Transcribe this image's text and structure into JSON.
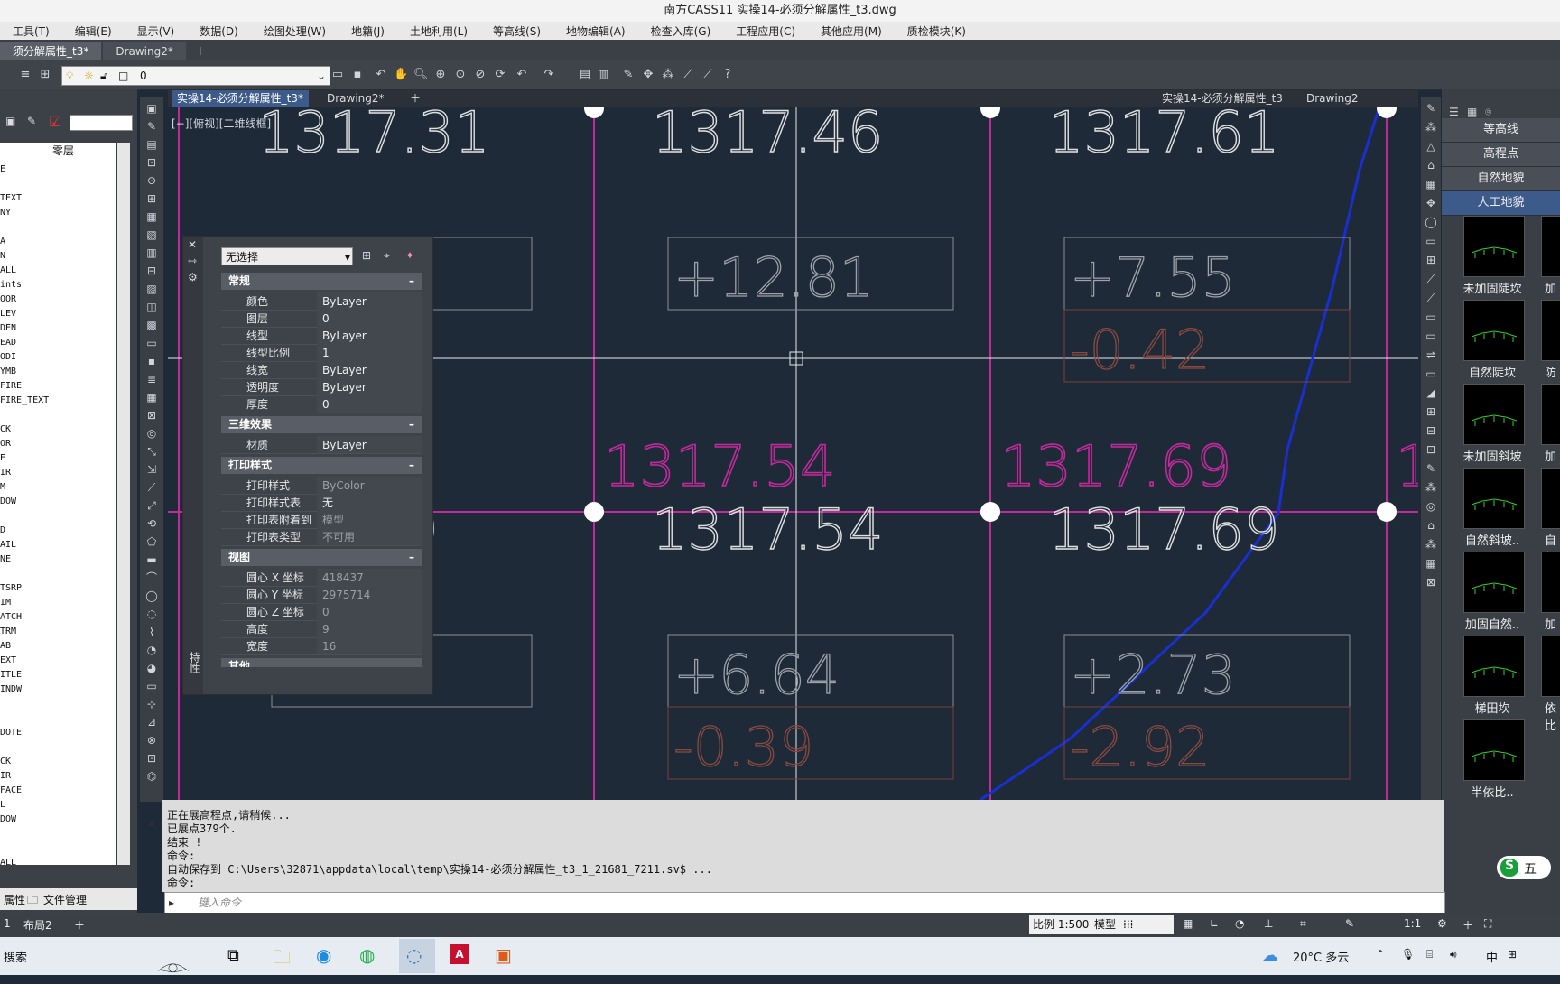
{
  "title": "南方CASS11      实操14-必须分解属性_t3.dwg",
  "menu": [
    "工具(T)",
    "编辑(E)",
    "显示(V)",
    "数据(D)",
    "绘图处理(W)",
    "地籍(J)",
    "土地利用(L)",
    "等高线(S)",
    "地物编辑(A)",
    "检查入库(G)",
    "工程应用(C)",
    "其他应用(M)",
    "质检模块(K)"
  ],
  "doc_tabs": [
    "须分解属性_t3*",
    "Drawing2*"
  ],
  "layer_value": "0",
  "viewport_tabs": [
    "实操14-必须分解属性_t3*",
    "Drawing2*"
  ],
  "viewport_tabs_right": [
    "实操14-必须分解属性_t3",
    "Drawing2"
  ],
  "view_label": "[−][俯视][二维线框]",
  "left_panel": {
    "header": "零层",
    "items": [
      "E",
      "",
      "TEXT",
      "NY",
      "",
      "A",
      "N",
      "ALL",
      "ints",
      "OOR",
      "LEV",
      "DEN",
      "EAD",
      "ODI",
      "YMB",
      "FIRE",
      "FIRE_TEXT",
      "",
      "CK",
      "OR",
      "E",
      "IR",
      "M",
      "DOW",
      "",
      "D",
      "AIL",
      "NE",
      "",
      "TSRP",
      "IM",
      "ATCH",
      "TRM",
      "AB",
      "EXT",
      "ITLE",
      "INDW",
      "",
      "",
      "DOTE",
      "",
      "CK",
      "IR",
      "FACE",
      "L",
      "DOW",
      "",
      "",
      "ALL"
    ],
    "bottom_tabs": [
      "属性",
      "文件管理"
    ]
  },
  "layout_tabs": [
    "1",
    "布局2"
  ],
  "drawing": {
    "labels_white": [
      "1317.31",
      "1317.46",
      "1317.61",
      "1317.54",
      "1317.69",
      "9"
    ],
    "labels_magenta": [
      "1317.54",
      "1317.69",
      "1"
    ],
    "boxes_top": [
      "+12.81",
      "+7.55"
    ],
    "boxes_top_red": [
      "-0.42"
    ],
    "boxes_bottom": [
      "+6.64",
      "+2.73"
    ],
    "boxes_bottom_red": [
      "-0.39",
      "-2.92"
    ]
  },
  "properties": {
    "selection": "无选择",
    "side_label": "特性",
    "sections": [
      {
        "title": "常规",
        "rows": [
          {
            "k": "颜色",
            "v": "ByLayer"
          },
          {
            "k": "图层",
            "v": "0"
          },
          {
            "k": "线型",
            "v": "ByLayer"
          },
          {
            "k": "线型比例",
            "v": "1"
          },
          {
            "k": "线宽",
            "v": "ByLayer"
          },
          {
            "k": "透明度",
            "v": "ByLayer"
          },
          {
            "k": "厚度",
            "v": "0"
          }
        ]
      },
      {
        "title": "三维效果",
        "rows": [
          {
            "k": "材质",
            "v": "ByLayer"
          }
        ]
      },
      {
        "title": "打印样式",
        "rows": [
          {
            "k": "打印样式",
            "v": "ByColor"
          },
          {
            "k": "打印样式表",
            "v": "无"
          },
          {
            "k": "打印表附着到",
            "v": "模型"
          },
          {
            "k": "打印表类型",
            "v": "不可用"
          }
        ]
      },
      {
        "title": "视图",
        "rows": [
          {
            "k": "圆心 X 坐标",
            "v": "418437"
          },
          {
            "k": "圆心 Y 坐标",
            "v": "2975714"
          },
          {
            "k": "圆心 Z 坐标",
            "v": "0"
          },
          {
            "k": "高度",
            "v": "9"
          },
          {
            "k": "宽度",
            "v": "16"
          }
        ]
      }
    ],
    "last_section": "其他"
  },
  "right_panel": {
    "categories": [
      "等高线",
      "高程点",
      "自然地貌",
      "人工地貌"
    ],
    "thumbs": [
      "未加固陡坎",
      "自然陡坎",
      "未加固斜坡",
      "自然斜坡..",
      "加固自然..",
      "梯田坎",
      "半依比.."
    ],
    "thumbs_col2": [
      "加",
      "防风",
      "加",
      "自然",
      "加固",
      "依比"
    ]
  },
  "command_lines": [
    "正在展高程点,请稍候...",
    "已展点379个.",
    "结束 !",
    "命令:",
    "自动保存到 C:\\Users\\32871\\appdata\\local\\temp\\实操14-必须分解属性_t3_1_21681_7211.sv$ ...",
    "命令:"
  ],
  "command_placeholder": "键入命令",
  "status": {
    "scale": "比例 1:500",
    "model": "模型",
    "ratio": "1:1"
  },
  "taskbar": {
    "search": "搜索",
    "weather": "20°C 多云",
    "ime": "中",
    "ime2": "五"
  }
}
